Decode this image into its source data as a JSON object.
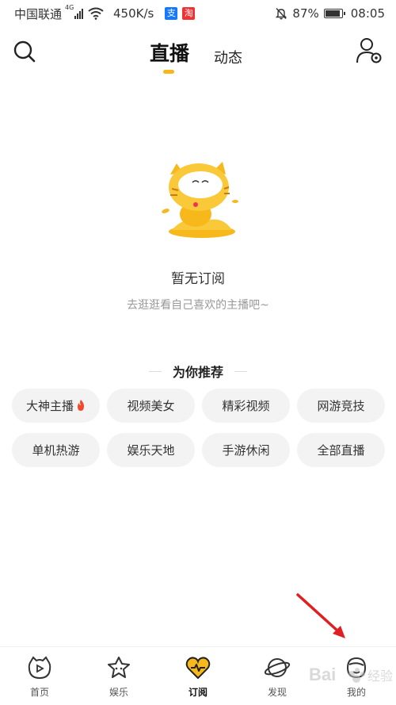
{
  "status_bar": {
    "carrier": "中国联通",
    "network": "4G",
    "speed": "450K/s",
    "battery": "87%",
    "battery_level": 0.87,
    "time": "08:05"
  },
  "header": {
    "tabs": [
      {
        "label": "直播",
        "active": true
      },
      {
        "label": "动态",
        "active": false
      }
    ]
  },
  "empty_state": {
    "title": "暂无订阅",
    "subtitle": "去逛逛看自己喜欢的主播吧~"
  },
  "recommend": {
    "title": "为你推荐",
    "tags": [
      "大神主播",
      "视频美女",
      "精彩视频",
      "网游竞技",
      "单机热游",
      "娱乐天地",
      "手游休闲",
      "全部直播"
    ]
  },
  "bottom_nav": {
    "items": [
      {
        "label": "首页",
        "icon": "home-icon"
      },
      {
        "label": "娱乐",
        "icon": "star-icon"
      },
      {
        "label": "订阅",
        "icon": "heart-icon",
        "active": true
      },
      {
        "label": "发现",
        "icon": "planet-icon"
      },
      {
        "label": "我的",
        "icon": "profile-icon"
      }
    ]
  },
  "colors": {
    "accent": "#f6b81b",
    "arrow": "#e02020"
  }
}
